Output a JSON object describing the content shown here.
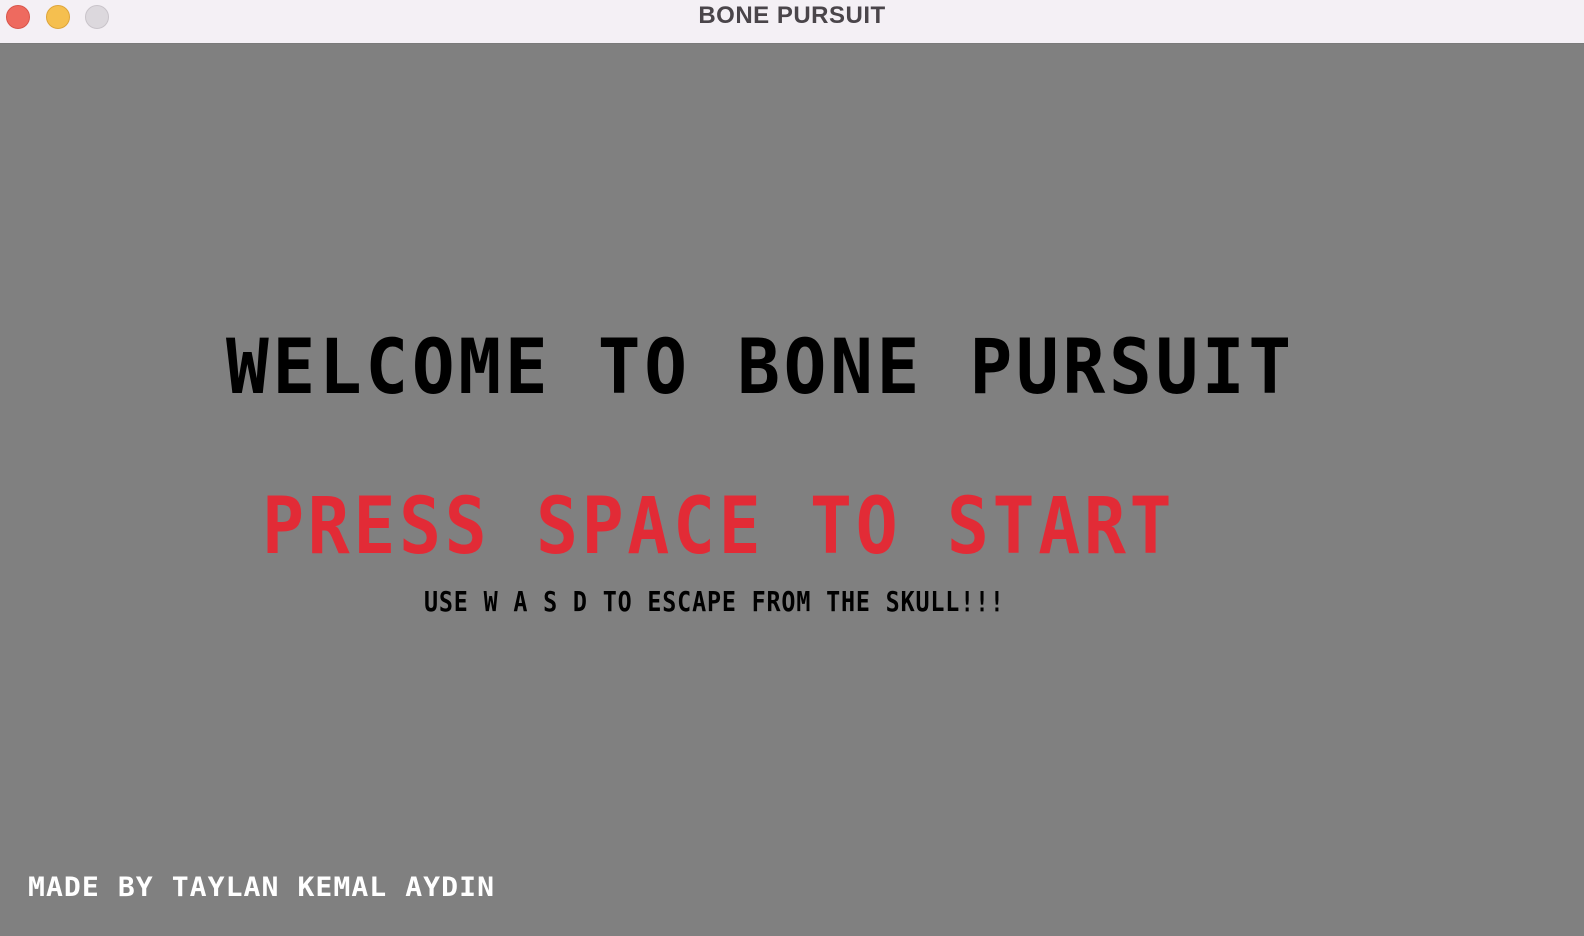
{
  "window": {
    "title": "BONE PURSUIT"
  },
  "game": {
    "welcome_text": "WELCOME TO BONE PURSUIT",
    "start_prompt": "PRESS SPACE TO START",
    "instructions": "USE W A S D TO ESCAPE FROM THE SKULL!!!",
    "credits": "MADE BY TAYLAN KEMAL AYDIN"
  },
  "colors": {
    "background": "#808080",
    "welcome_text": "#000000",
    "start_prompt": "#e22b36",
    "instructions": "#000000",
    "credits": "#ffffff"
  }
}
